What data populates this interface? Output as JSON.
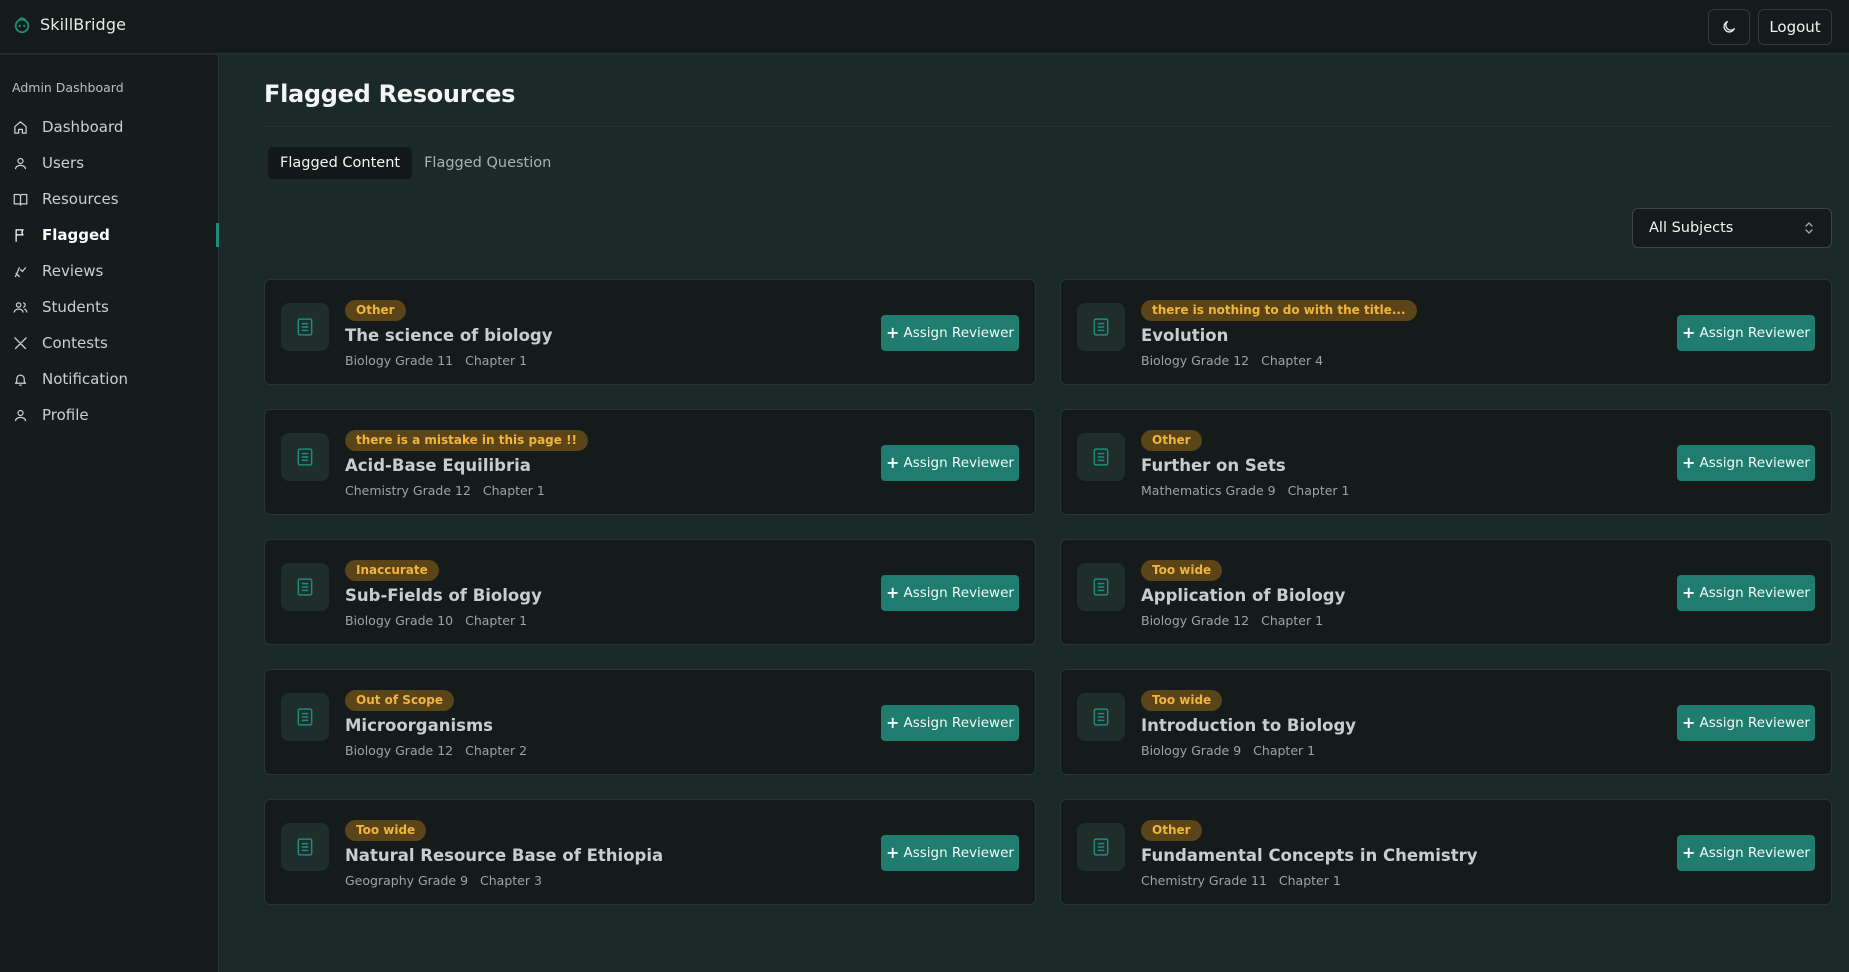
{
  "app": {
    "brand": "SkillBridge",
    "logout_label": "Logout",
    "theme_icon": "moon-icon"
  },
  "sidebar": {
    "section_label": "Admin Dashboard",
    "items": [
      {
        "label": "Dashboard",
        "icon": "home-icon"
      },
      {
        "label": "Users",
        "icon": "user-icon"
      },
      {
        "label": "Resources",
        "icon": "book-open-icon"
      },
      {
        "label": "Flagged",
        "icon": "flag-icon",
        "active": true
      },
      {
        "label": "Reviews",
        "icon": "review-icon"
      },
      {
        "label": "Students",
        "icon": "users-icon"
      },
      {
        "label": "Contests",
        "icon": "swords-icon"
      },
      {
        "label": "Notification",
        "icon": "bell-icon"
      },
      {
        "label": "Profile",
        "icon": "user-icon"
      }
    ]
  },
  "main": {
    "title": "Flagged Resources",
    "tabs": [
      {
        "label": "Flagged Content",
        "active": true
      },
      {
        "label": "Flagged Question",
        "active": false
      }
    ],
    "filter": {
      "value": "All Subjects"
    },
    "assign_label": "Assign Reviewer",
    "cards": [
      {
        "tag": "Other",
        "title": "The science of biology",
        "course": "Biology Grade 11",
        "chapter": "Chapter 1"
      },
      {
        "tag": "there is nothing to do with the title...",
        "title": "Evolution",
        "course": "Biology Grade 12",
        "chapter": "Chapter 4"
      },
      {
        "tag": "there is a mistake in this page !!",
        "title": "Acid-Base Equilibria",
        "course": "Chemistry Grade 12",
        "chapter": "Chapter 1"
      },
      {
        "tag": "Other",
        "title": "Further on Sets",
        "course": "Mathematics Grade 9",
        "chapter": "Chapter 1"
      },
      {
        "tag": "Inaccurate",
        "title": "Sub-Fields of Biology",
        "course": "Biology Grade 10",
        "chapter": "Chapter 1"
      },
      {
        "tag": "Too wide",
        "title": "Application of Biology",
        "course": "Biology Grade 12",
        "chapter": "Chapter 1"
      },
      {
        "tag": "Out of Scope",
        "title": "Microorganisms",
        "course": "Biology Grade 12",
        "chapter": "Chapter 2"
      },
      {
        "tag": "Too wide",
        "title": "Introduction to Biology",
        "course": "Biology Grade 9",
        "chapter": "Chapter 1"
      },
      {
        "tag": "Too wide",
        "title": "Natural Resource Base of Ethiopia",
        "course": "Geography Grade 9",
        "chapter": "Chapter 3"
      },
      {
        "tag": "Other",
        "title": "Fundamental Concepts in Chemistry",
        "course": "Chemistry Grade 11",
        "chapter": "Chapter 1"
      }
    ]
  },
  "colors": {
    "accent": "#1e7d6f",
    "badge_bg": "#5a4418",
    "badge_text": "#f1b53d",
    "page_bg": "#1b2a28"
  }
}
